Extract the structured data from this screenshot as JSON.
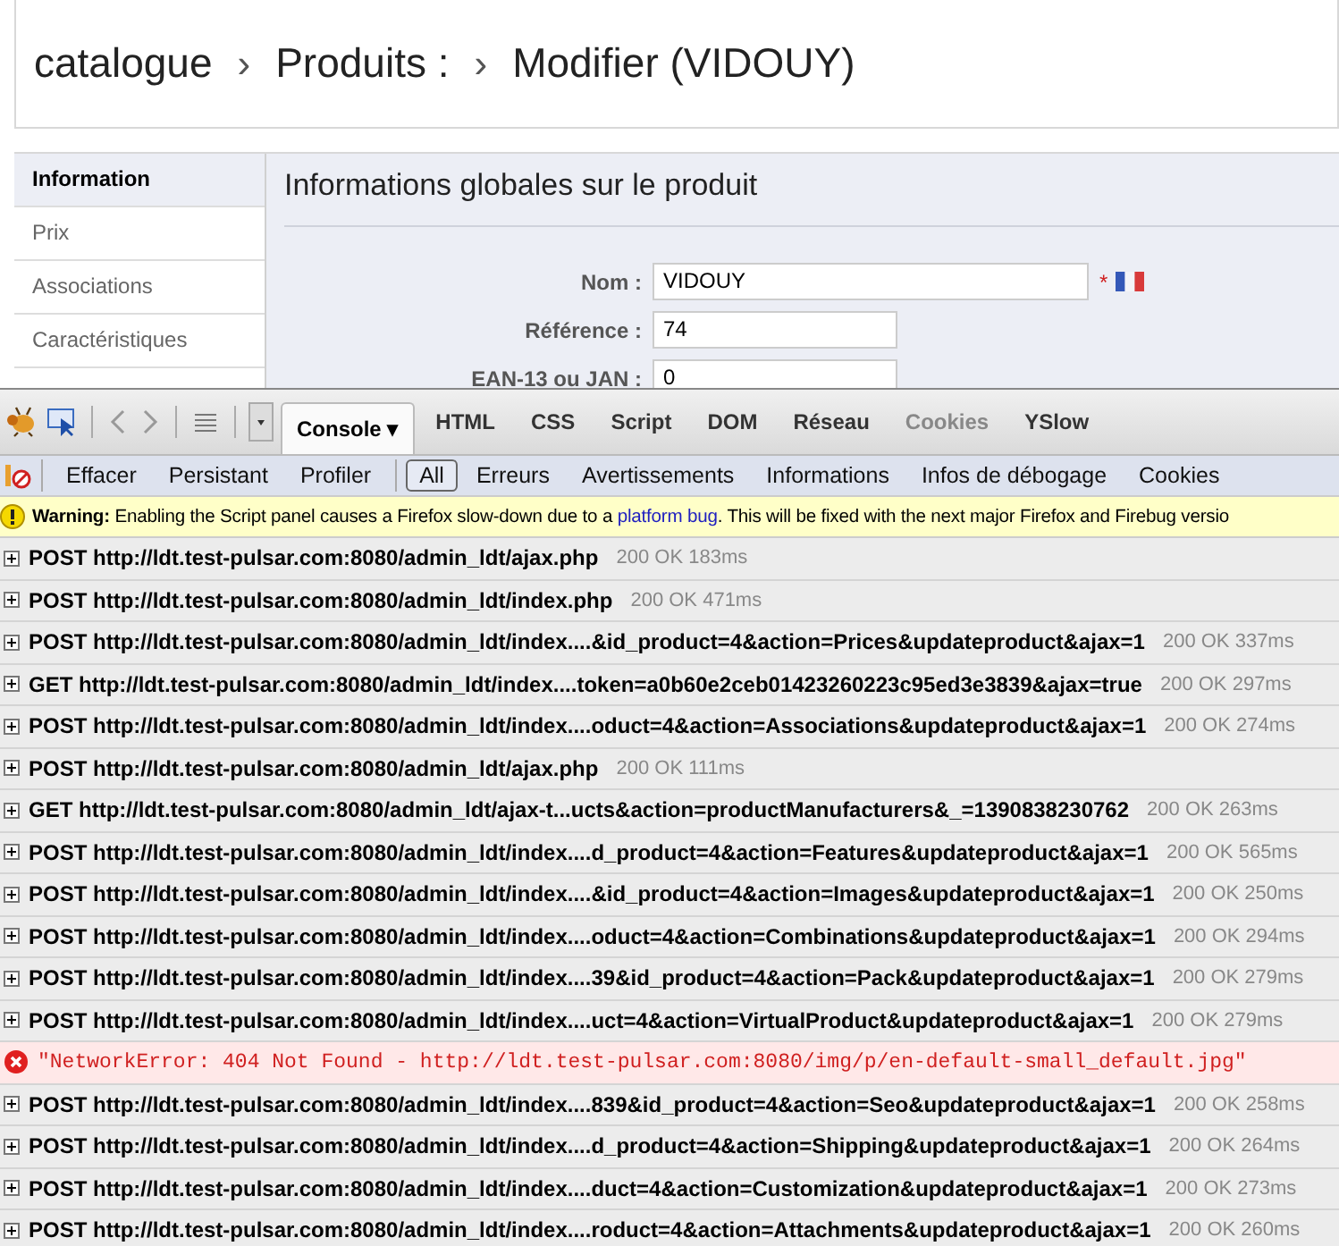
{
  "breadcrumb": {
    "separator": "›",
    "items": [
      "catalogue",
      "Produits :",
      "Modifier (VIDOUY)"
    ]
  },
  "sidebar": {
    "items": [
      {
        "label": "Information",
        "selected": true
      },
      {
        "label": "Prix",
        "selected": false
      },
      {
        "label": "Associations",
        "selected": false
      },
      {
        "label": "Caractéristiques",
        "selected": false
      }
    ]
  },
  "panel": {
    "title": "Informations globales sur le produit",
    "fields": [
      {
        "label": "Nom :",
        "value": "VIDOUY",
        "required_mark": "*",
        "flag": true,
        "wide": true
      },
      {
        "label": "Référence :",
        "value": "74",
        "flag": false,
        "wide": false
      },
      {
        "label": "EAN-13 ou JAN :",
        "value": "0",
        "flag": false,
        "wide": false
      }
    ]
  },
  "firebug": {
    "tabs": [
      {
        "label": "Console ▾",
        "selected": true,
        "disabled": false
      },
      {
        "label": "HTML",
        "selected": false,
        "disabled": false
      },
      {
        "label": "CSS",
        "selected": false,
        "disabled": false
      },
      {
        "label": "Script",
        "selected": false,
        "disabled": false
      },
      {
        "label": "DOM",
        "selected": false,
        "disabled": false
      },
      {
        "label": "Réseau",
        "selected": false,
        "disabled": false
      },
      {
        "label": "Cookies",
        "selected": false,
        "disabled": true
      },
      {
        "label": "YSlow",
        "selected": false,
        "disabled": false
      }
    ],
    "actions": [
      "Effacer",
      "Persistant",
      "Profiler"
    ],
    "filters": [
      {
        "label": "All",
        "selected": true
      },
      {
        "label": "Erreurs",
        "selected": false
      },
      {
        "label": "Avertissements",
        "selected": false
      },
      {
        "label": "Informations",
        "selected": false
      },
      {
        "label": "Infos de débogage",
        "selected": false
      },
      {
        "label": "Cookies",
        "selected": false
      }
    ],
    "warning": {
      "prefix": "Warning:",
      "text": "Enabling the Script panel causes a Firefox slow-down due to a",
      "link": "platform bug",
      "suffix": ". This will be fixed with the next major Firefox and Firebug versio"
    },
    "log": [
      {
        "kind": "request",
        "text": "POST http://ldt.test-pulsar.com:8080/admin_ldt/ajax.php",
        "status": "200 OK 183ms"
      },
      {
        "kind": "request",
        "text": "POST http://ldt.test-pulsar.com:8080/admin_ldt/index.php",
        "status": "200 OK 471ms"
      },
      {
        "kind": "request",
        "text": "POST http://ldt.test-pulsar.com:8080/admin_ldt/index....&id_product=4&action=Prices&updateproduct&ajax=1",
        "status": "200 OK 337ms"
      },
      {
        "kind": "request",
        "text": "GET http://ldt.test-pulsar.com:8080/admin_ldt/index....token=a0b60e2ceb01423260223c95ed3e3839&ajax=true",
        "status": "200 OK 297ms"
      },
      {
        "kind": "request",
        "text": "POST http://ldt.test-pulsar.com:8080/admin_ldt/index....oduct=4&action=Associations&updateproduct&ajax=1",
        "status": "200 OK 274ms"
      },
      {
        "kind": "request",
        "text": "POST http://ldt.test-pulsar.com:8080/admin_ldt/ajax.php",
        "status": "200 OK 111ms"
      },
      {
        "kind": "request",
        "text": "GET http://ldt.test-pulsar.com:8080/admin_ldt/ajax-t...ucts&action=productManufacturers&_=1390838230762",
        "status": "200 OK 263ms"
      },
      {
        "kind": "request",
        "text": "POST http://ldt.test-pulsar.com:8080/admin_ldt/index....d_product=4&action=Features&updateproduct&ajax=1",
        "status": "200 OK 565ms"
      },
      {
        "kind": "request",
        "text": "POST http://ldt.test-pulsar.com:8080/admin_ldt/index....&id_product=4&action=Images&updateproduct&ajax=1",
        "status": "200 OK 250ms"
      },
      {
        "kind": "request",
        "text": "POST http://ldt.test-pulsar.com:8080/admin_ldt/index....oduct=4&action=Combinations&updateproduct&ajax=1",
        "status": "200 OK 294ms"
      },
      {
        "kind": "request",
        "text": "POST http://ldt.test-pulsar.com:8080/admin_ldt/index....39&id_product=4&action=Pack&updateproduct&ajax=1",
        "status": "200 OK 279ms"
      },
      {
        "kind": "request",
        "text": "POST http://ldt.test-pulsar.com:8080/admin_ldt/index....uct=4&action=VirtualProduct&updateproduct&ajax=1",
        "status": "200 OK 279ms"
      },
      {
        "kind": "error",
        "text": "\"NetworkError: 404 Not Found - http://ldt.test-pulsar.com:8080/img/p/en-default-small_default.jpg\""
      },
      {
        "kind": "request",
        "text": "POST http://ldt.test-pulsar.com:8080/admin_ldt/index....839&id_product=4&action=Seo&updateproduct&ajax=1",
        "status": "200 OK 258ms"
      },
      {
        "kind": "request",
        "text": "POST http://ldt.test-pulsar.com:8080/admin_ldt/index....d_product=4&action=Shipping&updateproduct&ajax=1",
        "status": "200 OK 264ms"
      },
      {
        "kind": "request",
        "text": "POST http://ldt.test-pulsar.com:8080/admin_ldt/index....duct=4&action=Customization&updateproduct&ajax=1",
        "status": "200 OK 273ms"
      },
      {
        "kind": "request",
        "text": "POST http://ldt.test-pulsar.com:8080/admin_ldt/index....roduct=4&action=Attachments&updateproduct&ajax=1",
        "status": "200 OK 260ms"
      }
    ]
  }
}
